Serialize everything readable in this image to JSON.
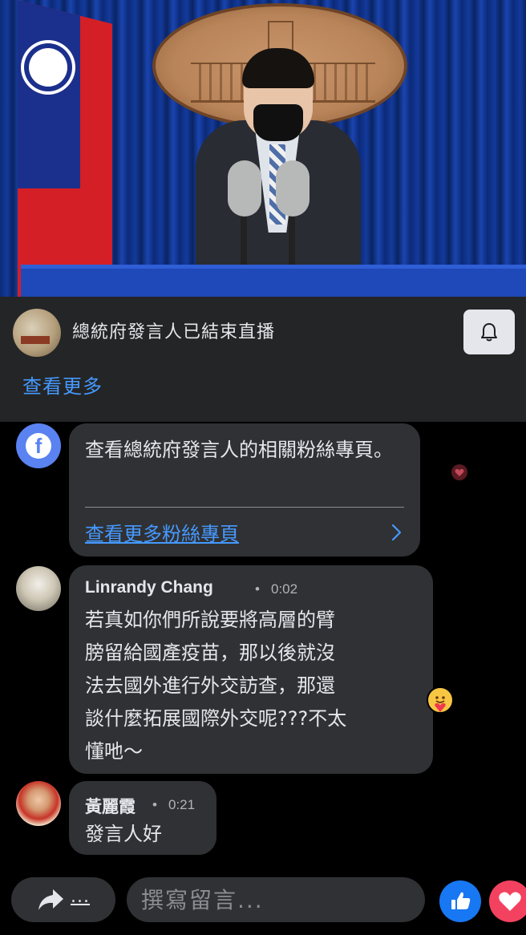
{
  "live": {
    "title": "總統府發言人已結束直播",
    "see_more": "查看更多"
  },
  "system_message": {
    "text": "查看總統府發言人的相關粉絲專頁。",
    "link_label": "查看更多粉絲專頁"
  },
  "comments": [
    {
      "author": "Linrandy Chang",
      "separator": "•",
      "time": "0:02",
      "lines": [
        "若真如你們所說要將高層的臂",
        "膀留給國產疫苗，那以後就沒",
        "法去國外進行外交訪查，那還",
        "談什麼拓展國際外交呢???不太",
        "懂吔～"
      ]
    },
    {
      "author": "黃麗霞",
      "separator": "•",
      "time": "0:21",
      "text": "發言人好"
    }
  ],
  "composer": {
    "share_label": "...",
    "placeholder": "撰寫留言..."
  },
  "colors": {
    "panel_bg": "#242526",
    "bubble_bg": "#303134",
    "link_blue": "#4599ff",
    "like_blue": "#1877f2",
    "love_red": "#f3425f"
  },
  "icons": [
    "bell-icon",
    "facebook-icon",
    "chevron-right-icon",
    "share-arrow-icon",
    "thumbs-up-icon",
    "heart-icon",
    "care-emoji-icon"
  ]
}
